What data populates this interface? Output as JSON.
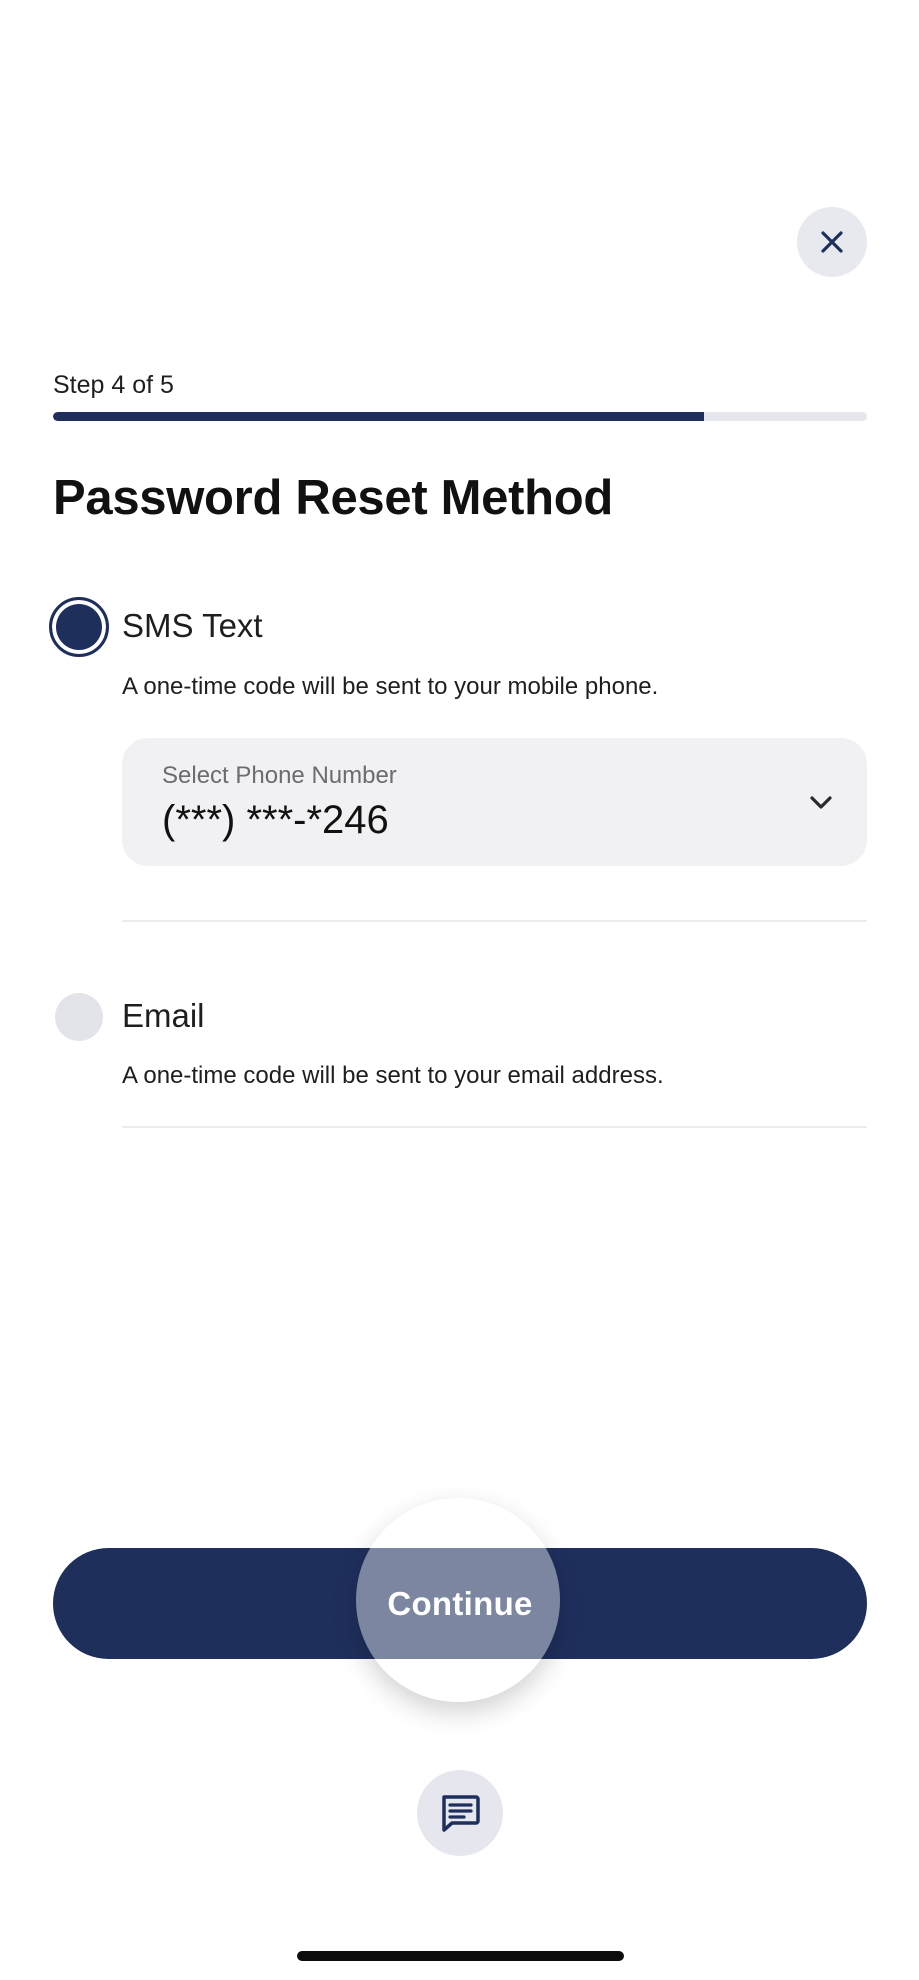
{
  "header": {
    "close_icon": "close-icon"
  },
  "progress": {
    "step_label": "Step 4 of 5",
    "current_step": 4,
    "total_steps": 5,
    "fill_fraction": 0.8
  },
  "page": {
    "title": "Password Reset Method"
  },
  "options": [
    {
      "label": "SMS Text",
      "description": "A one-time code will be sent to your mobile phone.",
      "selected": true,
      "phone_select": {
        "label": "Select Phone Number",
        "value": "(***) ***-*246",
        "icon": "chevron-down-icon"
      }
    },
    {
      "label": "Email",
      "description": "A one-time code will be sent to your email address.",
      "selected": false
    }
  ],
  "actions": {
    "continue_label": "Continue",
    "chat_icon": "chat-icon"
  },
  "colors": {
    "primary": "#1f2f5c",
    "radio_unselected": "#e3e4ea",
    "select_bg": "#f1f1f3",
    "progress_track": "#e6e7ec"
  }
}
